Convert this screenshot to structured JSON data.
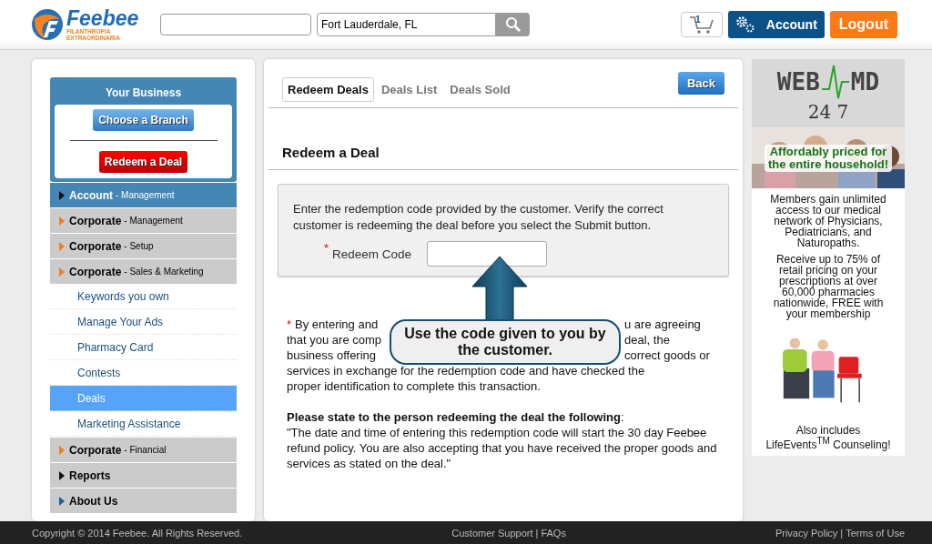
{
  "header": {
    "logo": {
      "name": "Feebee",
      "tagline_1": "FILANTHROPIA",
      "tagline_2": "EXTRAORDINARIA"
    },
    "location": {
      "value": "Fort Lauderdale, FL"
    },
    "cart": {
      "count": "1"
    },
    "account_button": "Account",
    "logout_button": "Logout"
  },
  "sidebar": {
    "business": {
      "title": "Your Business",
      "choose_button": "Choose a Branch",
      "redeem_button": "Redeem a Deal"
    },
    "items": [
      {
        "kind": "section",
        "title": "Account",
        "subtitle": "- Management",
        "selected": true,
        "color": "#111111"
      },
      {
        "kind": "section",
        "title": "Corporate",
        "subtitle": "- Management",
        "selected": false,
        "color": "#f07d1f"
      },
      {
        "kind": "section",
        "title": "Corporate",
        "subtitle": "- Setup",
        "selected": false,
        "color": "#f07d1f"
      },
      {
        "kind": "section",
        "title": "Corporate",
        "subtitle": "- Sales & Marketing",
        "selected": false,
        "color": "#f07d1f"
      },
      {
        "kind": "link",
        "title": "Keywords you own",
        "selected": false
      },
      {
        "kind": "link",
        "title": "Manage Your Ads",
        "selected": false
      },
      {
        "kind": "link",
        "title": "Pharmacy Card",
        "selected": false
      },
      {
        "kind": "link",
        "title": "Contests",
        "selected": false
      },
      {
        "kind": "link",
        "title": "Deals",
        "selected": true
      },
      {
        "kind": "link",
        "title": "Marketing Assistance",
        "selected": false
      },
      {
        "kind": "section",
        "title": "Corporate",
        "subtitle": "- Financial",
        "selected": false,
        "color": "#f07d1f"
      },
      {
        "kind": "section",
        "title": "Reports",
        "selected": false,
        "color": "#111111"
      },
      {
        "kind": "section",
        "title": "About Us",
        "selected": false,
        "color": "#1f5f9a"
      }
    ]
  },
  "main": {
    "tabs": [
      {
        "label": "Redeem Deals",
        "selected": true
      },
      {
        "label": "Deals List",
        "selected": false
      },
      {
        "label": "Deals Sold",
        "selected": false
      }
    ],
    "back_button": "Back",
    "heading": "Redeem a Deal",
    "instructions": "Enter the redemption code provided by the customer. Verify the correct customer is redeeming the deal before you select the Submit button.",
    "field": {
      "label": "Redeem Code",
      "required_mark": "*"
    },
    "disclaimer_mark": "*",
    "disclaimer_lines": [
      {
        "left": "By entering and",
        "right": "u are agreeing"
      },
      {
        "left": "that you are comp",
        "right": "deal, the"
      },
      {
        "left": "business offering",
        "right": "correct goods or"
      },
      {
        "left": "services in exchange for the redemption code and have checked the"
      },
      {
        "left": "proper identification to complete this transaction."
      }
    ],
    "statement": "**Please state to the person redeeming the deal the following**:",
    "quote": "\"The date and time of entering this redemption code will start the 30 day Feebee refund policy. You are also accepting that you have received the proper goods and services as stated on the deal.\"",
    "callout": "Use the code given to you by the customer."
  },
  "ad": {
    "logo_text": "WEB",
    "logo_text_2": "MD",
    "logo_number": "24 7",
    "banner": "Affordably priced for the entire household!",
    "paragraph_1": "Members gain unlimited access to our medical network of Physicians, Pediatricians, and Naturopaths.",
    "paragraph_2": "Receive up to 75% of retail pricing on your prescriptions at over 60,000 pharmacies nationwide, FREE with your  membership",
    "closing": "Also includes LifeEvents$^{TM}$ Counseling!"
  },
  "footer": {
    "copyright": "Copyright © 2014 Feebee. All Rights Reserved.",
    "support_link": "Customer Support",
    "faqs_link": "FAQs",
    "privacy_link": "Privacy Policy",
    "terms_link": "Terms of Use",
    "separator": "|"
  }
}
